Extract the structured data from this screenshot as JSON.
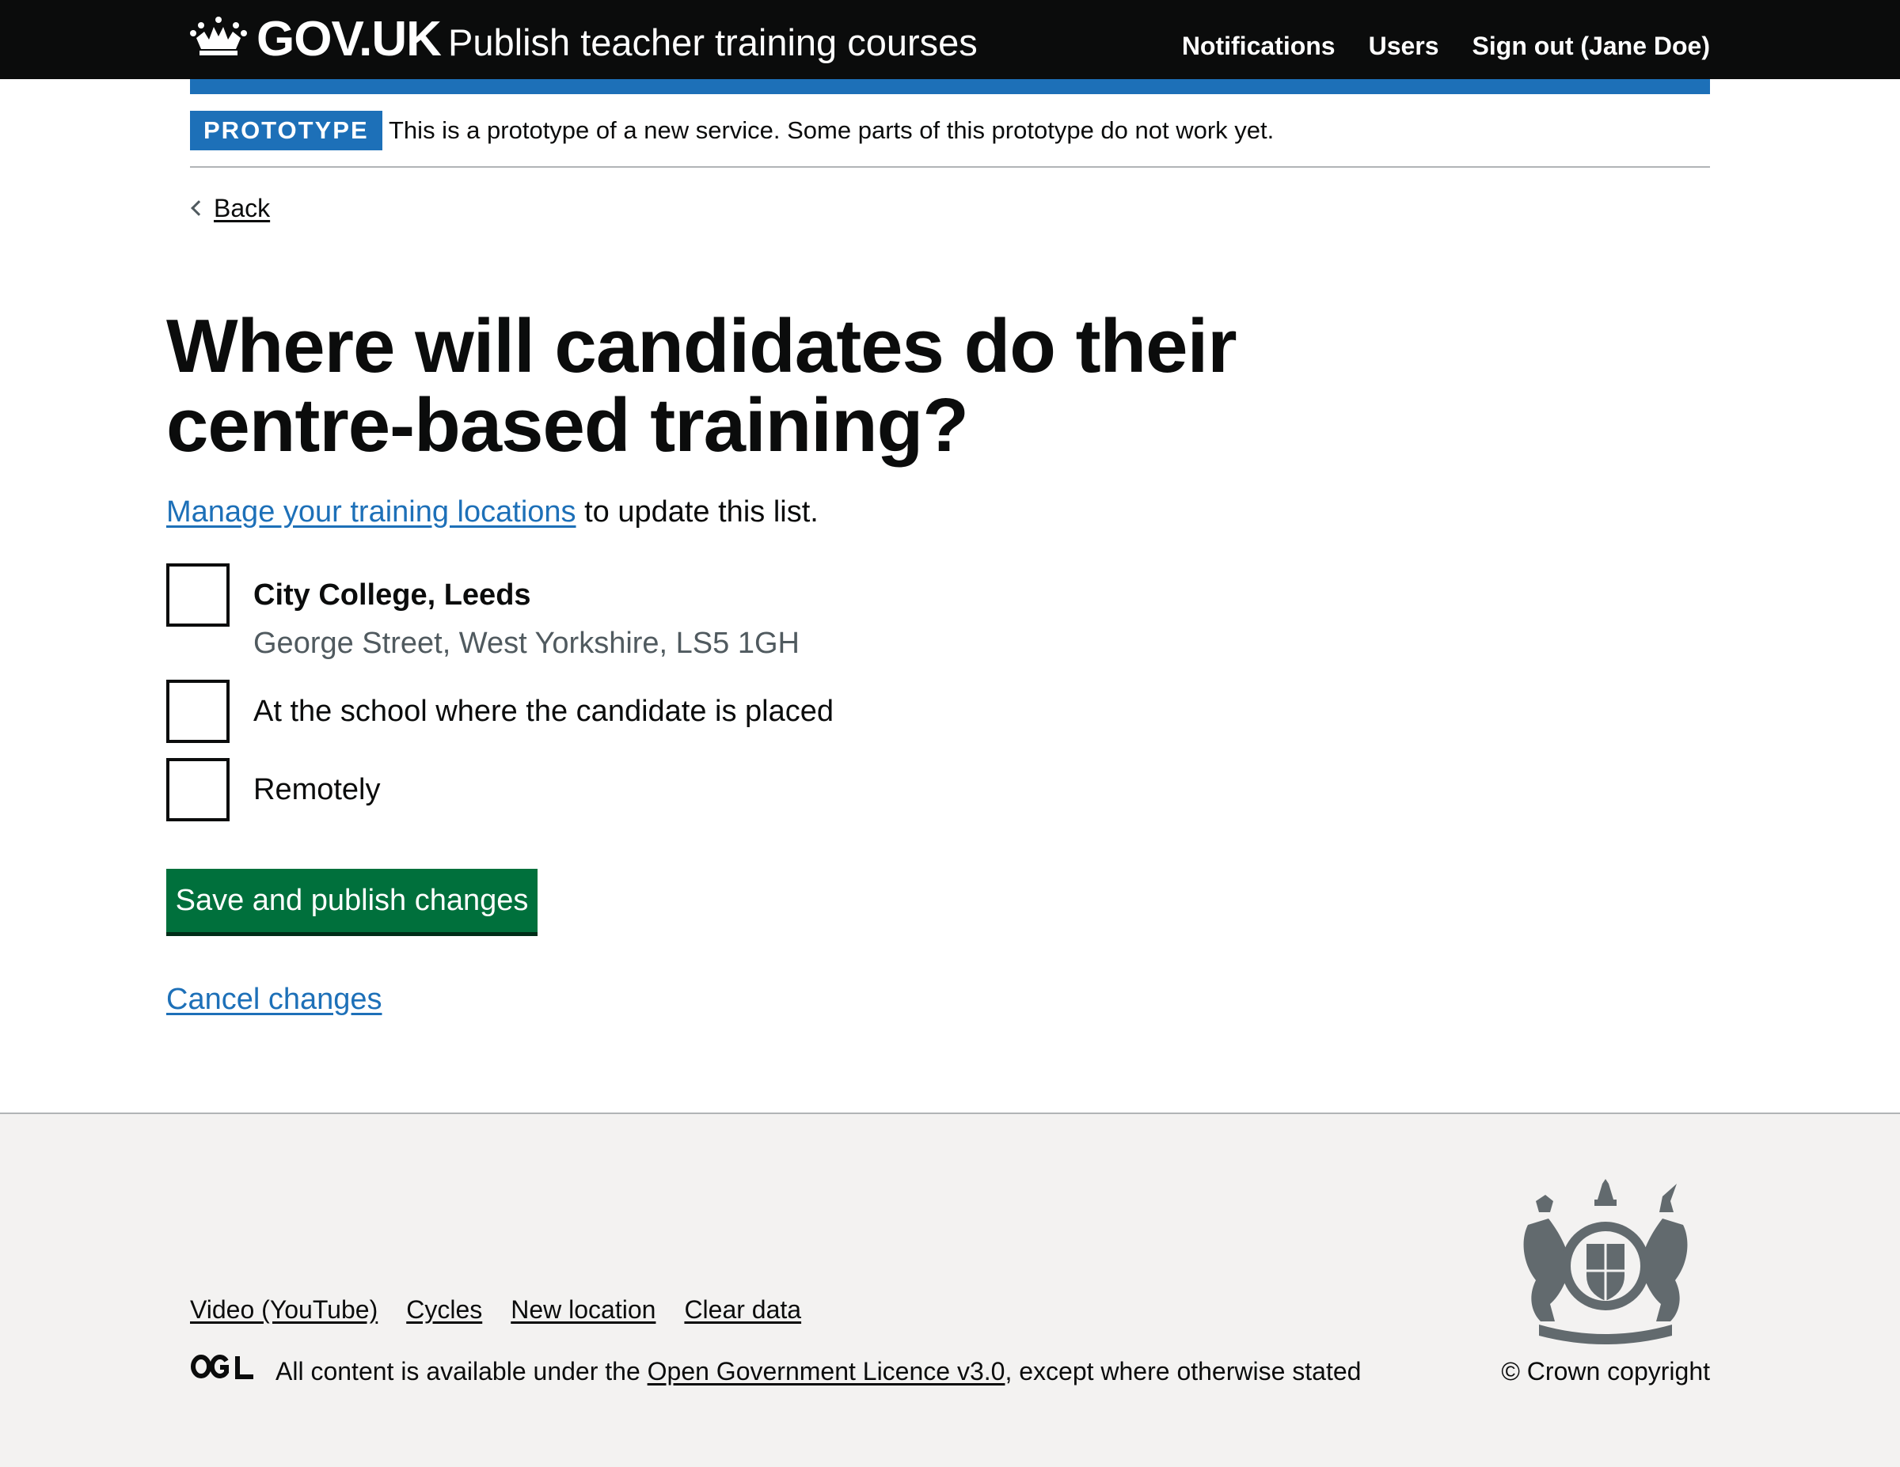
{
  "header": {
    "logotype": "GOV.UK",
    "service_name": "Publish teacher training courses",
    "nav": [
      "Notifications",
      "Users",
      "Sign out (Jane Doe)"
    ]
  },
  "phase_banner": {
    "tag": "PROTOTYPE",
    "text": "This is a prototype of a new service. Some parts of this prototype do not work yet."
  },
  "back_link": "Back",
  "main": {
    "title": "Where will candidates do their centre-based training?",
    "hint_link": "Manage your training locations",
    "hint_text": " to update this list.",
    "options": [
      {
        "label": "City College, Leeds",
        "hint": "George Street, West Yorkshire, LS5 1GH",
        "checked": false
      },
      {
        "label": "At the school where the candidate is placed",
        "checked": false
      },
      {
        "label": "Remotely",
        "checked": false
      }
    ],
    "submit_label": "Save and publish changes",
    "cancel_label": "Cancel changes"
  },
  "footer": {
    "links": [
      "Video (YouTube)",
      "Cycles",
      "New location",
      "Clear data"
    ],
    "licence_prefix": "All content is available under the ",
    "licence_link": "Open Government Licence v3.0",
    "licence_suffix": ", except where otherwise stated",
    "copyright": "© Crown copyright"
  },
  "colors": {
    "header_bg": "#0b0c0c",
    "brand_blue": "#1d70b8",
    "button_green": "#00703c",
    "footer_bg": "#f3f2f1",
    "hint_grey": "#505a5f"
  }
}
